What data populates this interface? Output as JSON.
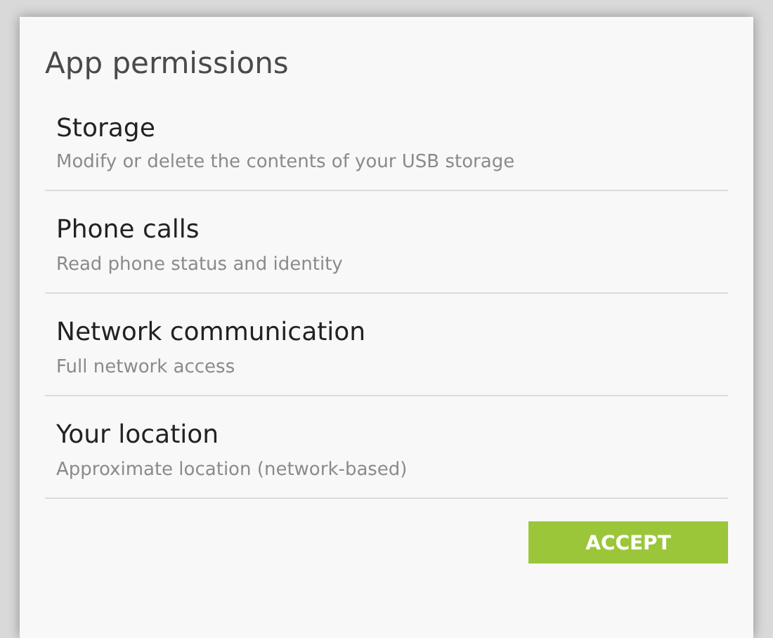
{
  "dialog": {
    "title": "App permissions",
    "permissions": [
      {
        "name": "Storage",
        "description": "Modify or delete the contents of your USB storage"
      },
      {
        "name": "Phone calls",
        "description": "Read phone status and identity"
      },
      {
        "name": "Network communication",
        "description": "Full network access"
      },
      {
        "name": "Your location",
        "description": "Approximate location (network-based)"
      }
    ],
    "buttons": [
      "ACCEPT"
    ]
  }
}
